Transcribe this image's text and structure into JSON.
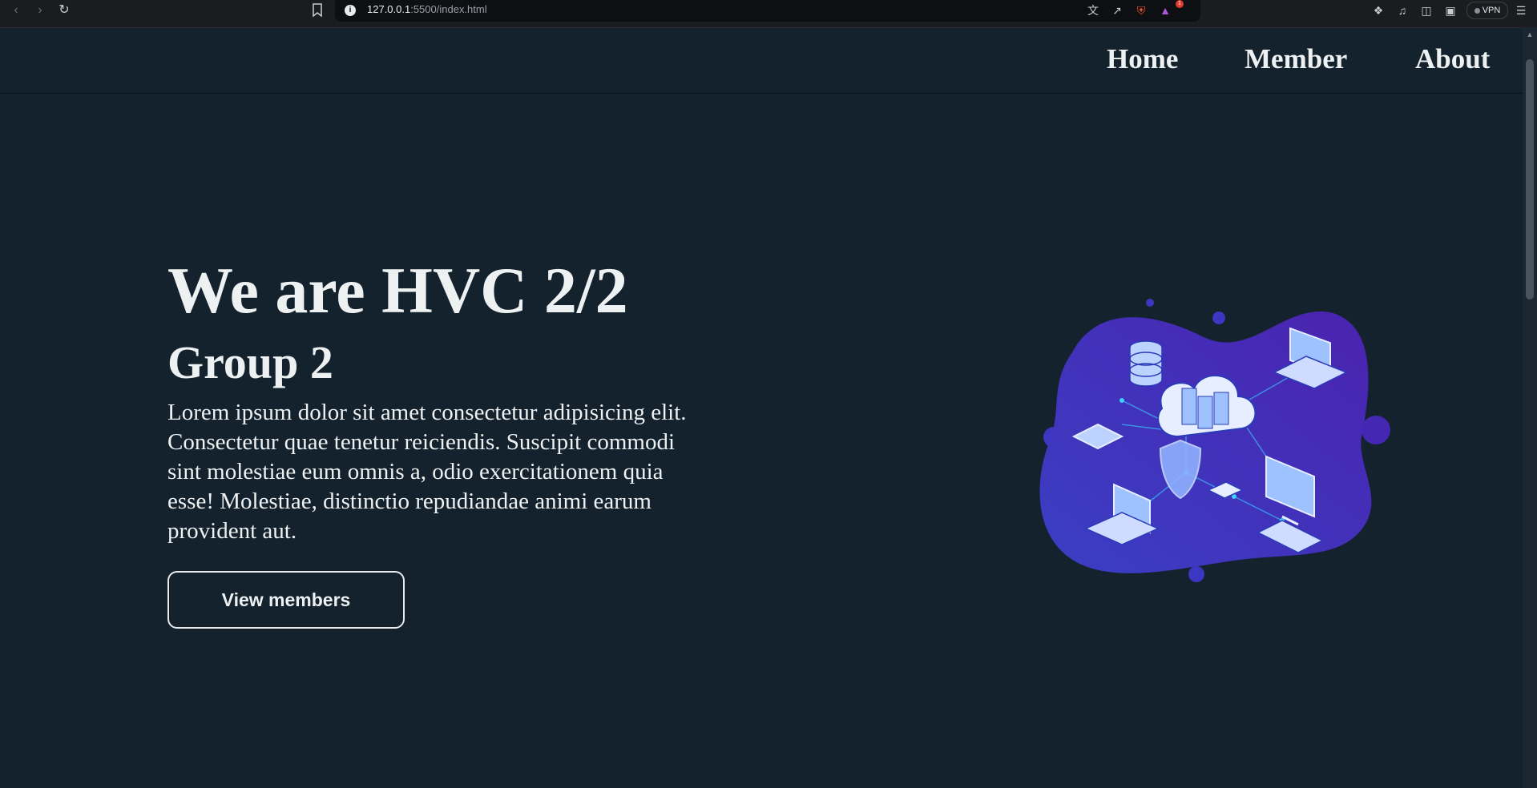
{
  "browser": {
    "url_host": "127.0.0.1",
    "url_rest": ":5500/index.html",
    "badge_count": "1",
    "vpn_label": "VPN",
    "icons": [
      "back-icon",
      "forward-icon",
      "reload-icon",
      "bookmark-icon",
      "site-info-icon",
      "translate-icon",
      "share-icon",
      "brave-shields-icon",
      "brave-rewards-icon",
      "extensions-icon",
      "media-icon",
      "sidebar-icon",
      "wallet-icon",
      "menu-icon"
    ]
  },
  "nav": {
    "items": [
      "Home",
      "Member",
      "About"
    ]
  },
  "hero": {
    "title": "We are HVC 2/2",
    "subtitle": "Group 2",
    "description": "Lorem ipsum dolor sit amet consectetur adipisicing elit. Consectetur quae tenetur reiciendis. Suscipit commodi sint molestiae eum omnis a, odio exercitationem quia esse! Molestiae, distinctio repudiandae animi earum provident aut.",
    "cta_label": "View members",
    "illustration": "cloud-network-illustration"
  },
  "colors": {
    "background": "#13222d",
    "text": "#eef1f2",
    "blob_start": "#3a3fc4",
    "blob_end": "#4a23b0",
    "device": "#9ec2ff"
  }
}
